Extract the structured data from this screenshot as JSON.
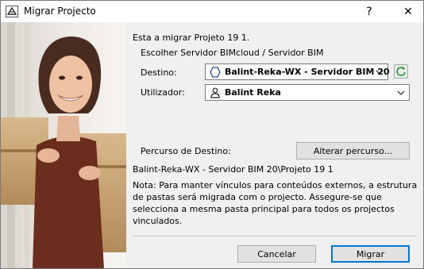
{
  "window": {
    "title": "Migrar Projecto",
    "help_glyph": "?",
    "close_glyph": "✕"
  },
  "main": {
    "heading": "Esta a migrar Projeto 19 1.",
    "server_choice_label": "Escolher Servidor BIMcloud / Servidor BIM",
    "destination_label": "Destino:",
    "destination_value": "Balint-Reka-WX - Servidor BIM 20",
    "user_label": "Utilizador:",
    "user_value": "Balint Reka",
    "path_label": "Percurso de Destino:",
    "change_path_button": "Alterar percurso...",
    "path_value": "Balint-Reka-WX - Servidor BIM 20\\Projeto 19 1",
    "note": "Nota: Para manter vínculos para conteúdos externos, a estrutura de pastas será migrada com o projecto. Assegure-se que selecciona a mesma pasta principal para todos os projectos vinculados."
  },
  "footer": {
    "cancel_button": "Cancelar",
    "migrate_button": "Migrar"
  },
  "icons": {
    "app": "archicad-app-icon",
    "destination": "server-hexagon-icon",
    "user": "user-icon",
    "refresh": "refresh-icon",
    "chevron": "chevron-down-icon"
  },
  "colors": {
    "default_button_border": "#0078d7",
    "refresh_icon": "#2e8b3a"
  }
}
